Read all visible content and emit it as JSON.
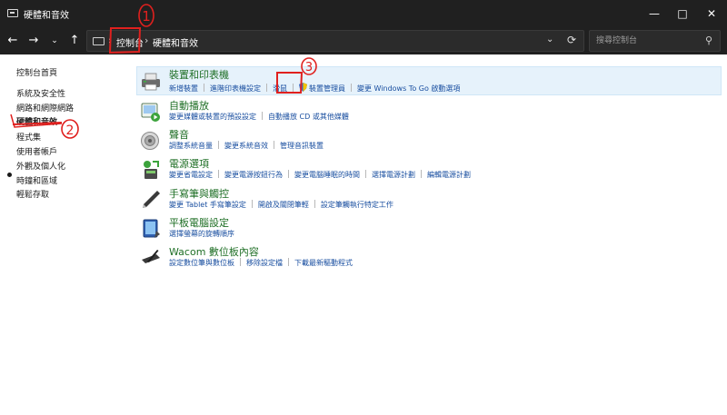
{
  "window": {
    "title": "硬體和音效"
  },
  "address_bar": {
    "breadcrumbs": [
      "控制台",
      "硬體和音效"
    ],
    "search_placeholder": "搜尋控制台"
  },
  "sidebar": {
    "items": [
      {
        "label": "控制台首頁"
      },
      {
        "label": "系統及安全性"
      },
      {
        "label": "網路和網際網路"
      },
      {
        "label": "硬體和音效",
        "active": true
      },
      {
        "label": "程式集"
      },
      {
        "label": "使用者帳戶"
      },
      {
        "label": "外觀及個人化"
      },
      {
        "label": "時鐘和區域"
      },
      {
        "label": "輕鬆存取"
      }
    ]
  },
  "categories": [
    {
      "title": "裝置和印表機",
      "icon": "printer-icon",
      "links": [
        "新增裝置",
        "進階印表機設定",
        "滑鼠",
        "裝置管理員",
        "變更 Windows To Go 啟動選項"
      ]
    },
    {
      "title": "自動播放",
      "icon": "autoplay-icon",
      "links": [
        "變更媒體或裝置的預設設定",
        "自動播放 CD 或其他媒體"
      ]
    },
    {
      "title": "聲音",
      "icon": "speaker-icon",
      "links": [
        "調整系統音量",
        "變更系統音效",
        "管理音訊裝置"
      ]
    },
    {
      "title": "電源選項",
      "icon": "power-options-icon",
      "links": [
        "變更省電設定",
        "變更電源按鈕行為",
        "變更電腦睡眠的時間",
        "選擇電源計劃",
        "編輯電源計劃"
      ]
    },
    {
      "title": "手寫筆與觸控",
      "icon": "pen-icon",
      "links": [
        "變更 Tablet 手寫筆設定",
        "開啟及關閉筆輕",
        "設定筆觸執行特定工作"
      ]
    },
    {
      "title": "平板電腦設定",
      "icon": "tablet-icon",
      "links": [
        "選擇螢幕的旋轉順序"
      ]
    },
    {
      "title": "Wacom 數位板內容",
      "icon": "wacom-tablet-icon",
      "links": [
        "設定數位筆與數位板",
        "移除設定檔",
        "下載最新驅動程式"
      ]
    }
  ],
  "annotations": [
    "1",
    "2",
    "3"
  ],
  "colors": {
    "titlebar": "#202020",
    "category_title": "#1f6f26",
    "link": "#1a4fa0",
    "highlight": "#e6f2fb",
    "annotation": "#e0201e"
  }
}
